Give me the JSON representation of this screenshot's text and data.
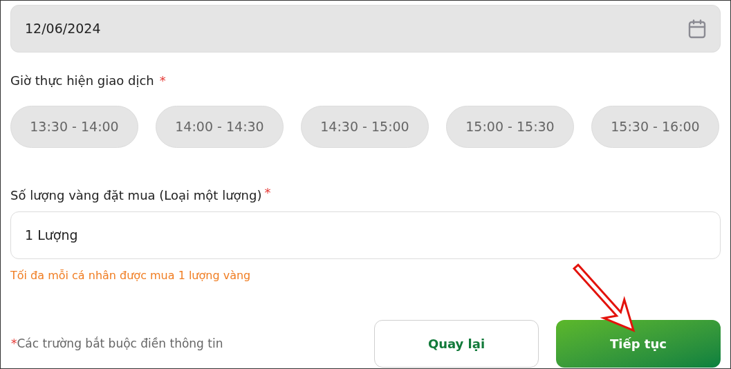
{
  "date_field": {
    "value": "12/06/2024",
    "disabled": true
  },
  "time_section": {
    "label": "Giờ thực hiện giao dịch",
    "required_mark": "*"
  },
  "time_slots": [
    {
      "label": "13:30 - 14:00",
      "selected": false
    },
    {
      "label": "14:00 - 14:30",
      "selected": false
    },
    {
      "label": "14:30 - 15:00",
      "selected": false
    },
    {
      "label": "15:00 - 15:30",
      "selected": false
    },
    {
      "label": "15:30 - 16:00",
      "selected": false
    }
  ],
  "quantity_section": {
    "label": "Số lượng vàng đặt mua (Loại một lượng)",
    "required_mark": "*",
    "value": "1 Lượng",
    "hint": "Tối đa mỗi cá nhân được mua 1 lượng vàng"
  },
  "footnote": {
    "mark": "*",
    "text": "Các trường bắt buộc điền thông tin"
  },
  "buttons": [
    {
      "label": "Quay lại",
      "kind": "secondary"
    },
    {
      "label": "Tiếp tục",
      "kind": "primary"
    }
  ]
}
